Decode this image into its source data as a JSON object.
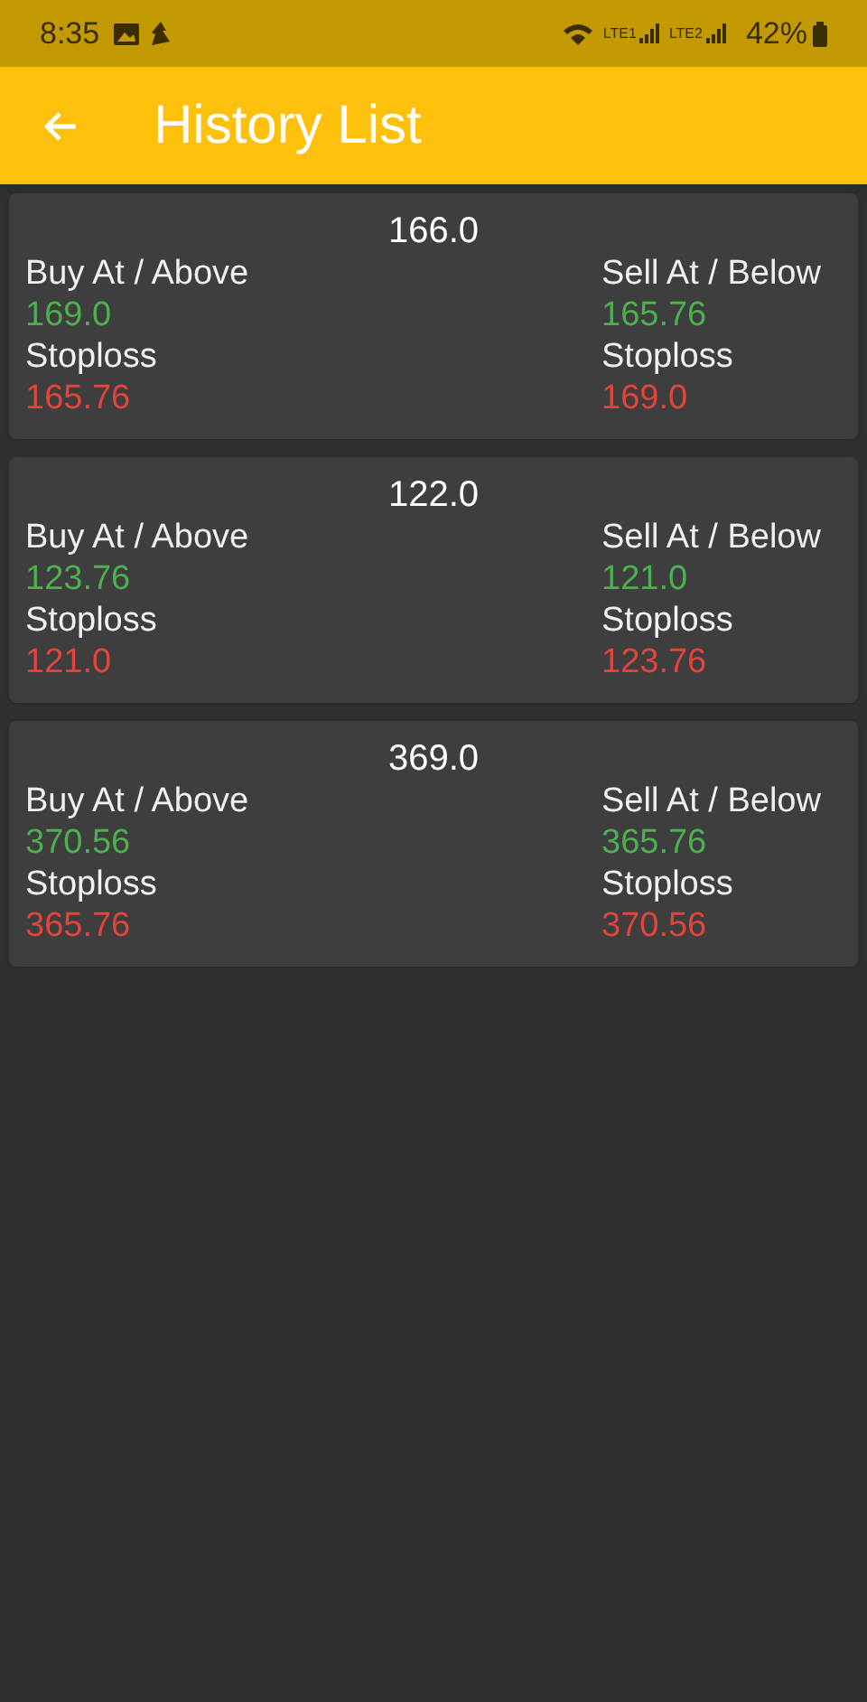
{
  "status_bar": {
    "time": "8:35",
    "sim_1": "LTE1",
    "sim_2": "LTE2",
    "battery": "42%"
  },
  "app_bar": {
    "title": "History List"
  },
  "items": [
    {
      "price": "166.0",
      "buy_label": "Buy At / Above",
      "buy": "169.0",
      "buy_stoploss_label": "Stoploss",
      "buy_stoploss": "165.76",
      "sell_label": "Sell At / Below",
      "sell": "165.76",
      "sell_stoploss_label": "Stoploss",
      "sell_stoploss": "169.0"
    },
    {
      "price": "122.0",
      "buy_label": "Buy At / Above",
      "buy": "123.76",
      "buy_stoploss_label": "Stoploss",
      "buy_stoploss": "121.0",
      "sell_label": "Sell At / Below",
      "sell": "121.0",
      "sell_stoploss_label": "Stoploss",
      "sell_stoploss": "123.76"
    },
    {
      "price": "369.0",
      "buy_label": "Buy At / Above",
      "buy": "370.56",
      "buy_stoploss_label": "Stoploss",
      "buy_stoploss": "365.76",
      "sell_label": "Sell At / Below",
      "sell": "365.76",
      "sell_stoploss_label": "Stoploss",
      "sell_stoploss": "370.56"
    }
  ]
}
